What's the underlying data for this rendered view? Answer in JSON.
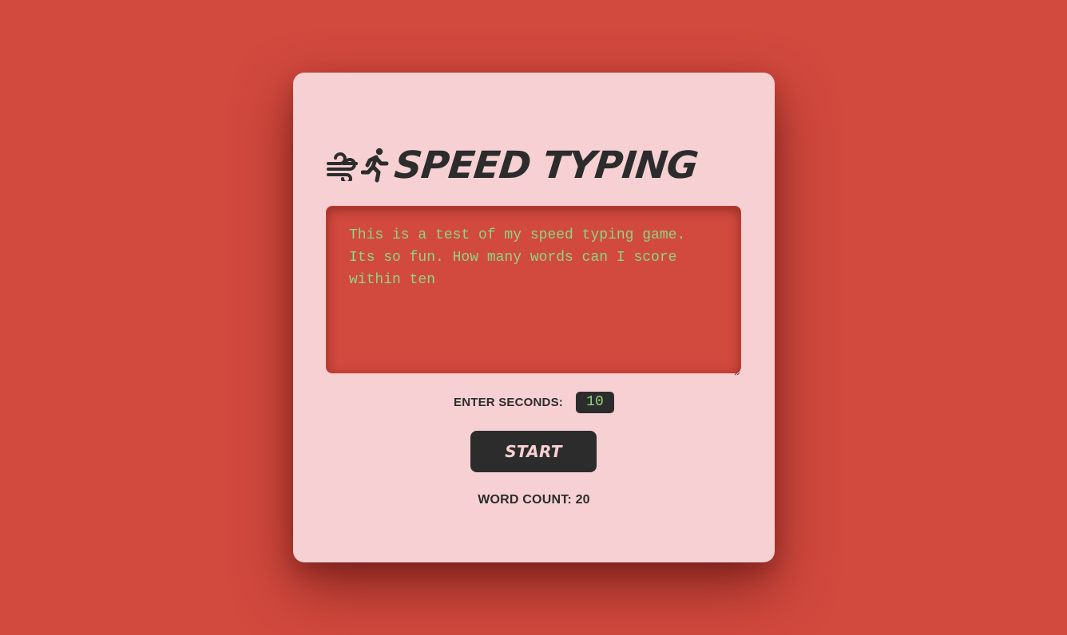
{
  "app": {
    "title": "SPEED TYPING",
    "title_icons": [
      "wind-icon",
      "running-person-icon"
    ]
  },
  "textarea": {
    "value": "This is a test of my speed typing game. Its so fun. How many words can I score within ten"
  },
  "seconds": {
    "label": "ENTER SECONDS:",
    "value": "10"
  },
  "start_button": {
    "label": "START"
  },
  "word_count": {
    "label": "WORD COUNT: 20"
  },
  "colors": {
    "background": "#d2493e",
    "card": "#f7d0d3",
    "dark": "#2c2c2c",
    "text_green": "#8fd57e"
  }
}
